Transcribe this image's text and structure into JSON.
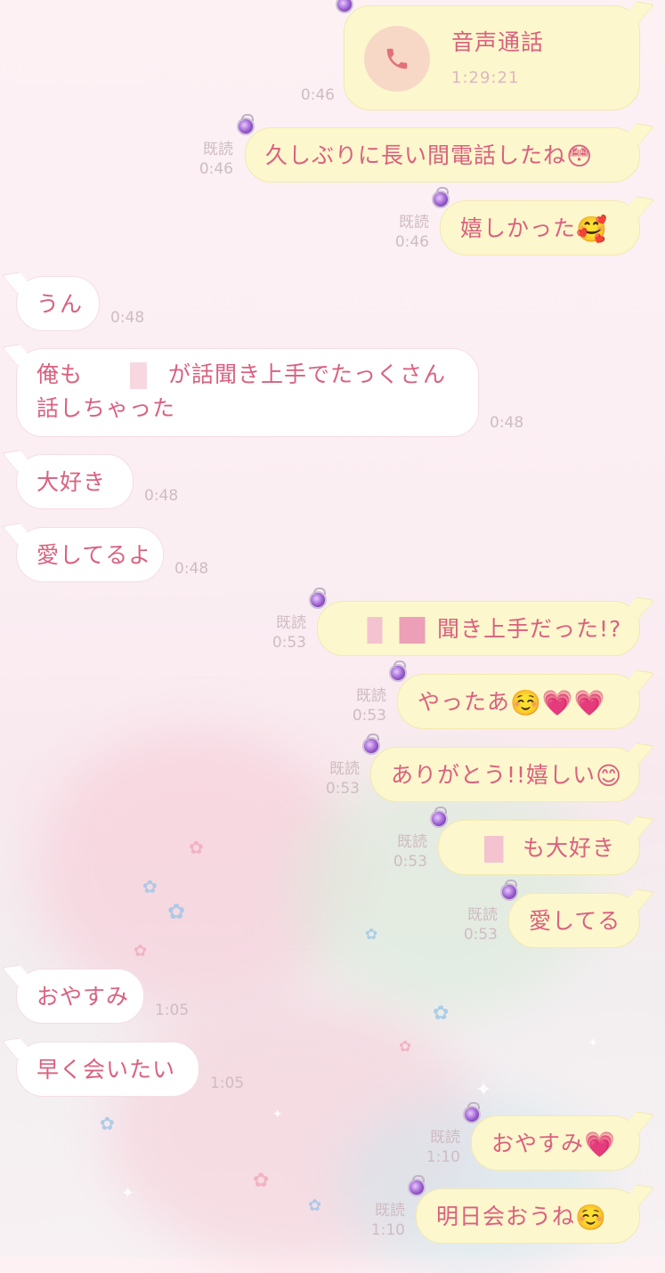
{
  "call": {
    "title": "音声通話",
    "duration": "1:29:21",
    "time": "0:46"
  },
  "read_label": "既読",
  "messages": [
    {
      "text": "久しぶりに長い間電話したね",
      "time": "0:46"
    },
    {
      "text": "嬉しかった",
      "time": "0:46"
    },
    {
      "text": "うん",
      "time": "0:48"
    },
    {
      "line1_pre": "俺も",
      "line1_post": "が話聞き上手でたっくさん",
      "line2": "話しちゃった",
      "time": "0:48"
    },
    {
      "text": "大好き",
      "time": "0:48"
    },
    {
      "text": "愛してるよ",
      "time": "0:48"
    },
    {
      "text": "聞き上手だった!?",
      "time": "0:53"
    },
    {
      "text": "やったあ",
      "time": "0:53"
    },
    {
      "text": "ありがとう!!嬉しい",
      "time": "0:53"
    },
    {
      "text": "も大好き",
      "time": "0:53"
    },
    {
      "text": "愛してる",
      "time": "0:53"
    },
    {
      "text": "おやすみ",
      "time": "1:05"
    },
    {
      "text": "早く会いたい",
      "time": "1:05"
    },
    {
      "text": "おやすみ",
      "time": "1:10"
    },
    {
      "text": "明日会おうね",
      "time": "1:10"
    }
  ],
  "icons": {
    "phone": "phone-icon",
    "ring": "ring-sticker-icon",
    "emojis": [
      "flushed-face",
      "smiling-face-with-hearts",
      "smiling-face",
      "growing-heart",
      "smiling-face-with-smiling-eyes"
    ]
  },
  "colors": {
    "text": "#d9617f",
    "right_bubble": "#fdf7cd",
    "left_bubble": "#ffffff",
    "meta": "#cfbcc2"
  }
}
